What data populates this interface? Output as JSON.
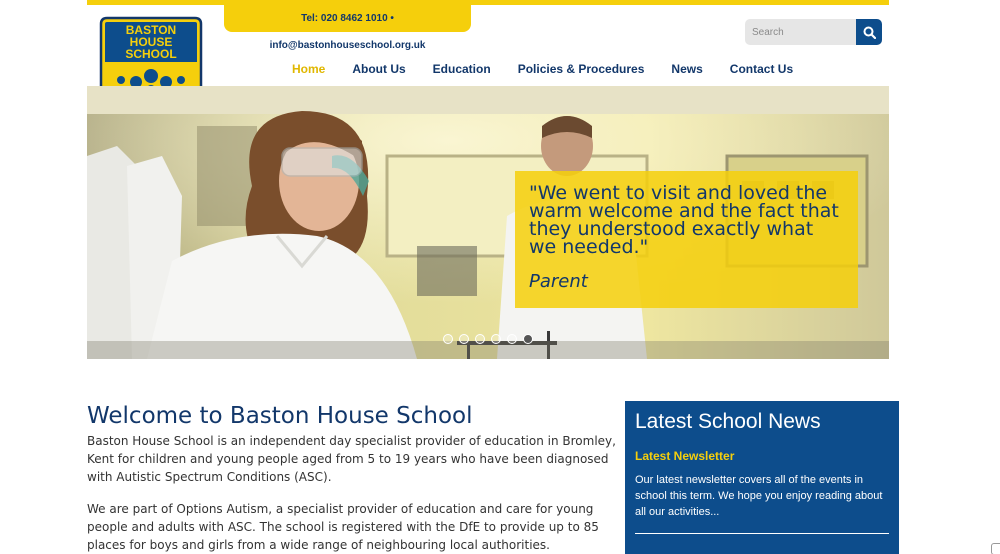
{
  "header": {
    "contact": "Tel: 020 8462 1010 • info@bastonhouseschool.org.uk",
    "logo_text": [
      "BASTON",
      "HOUSE",
      "SCHOOL"
    ],
    "search_placeholder": "Search"
  },
  "nav": {
    "items": [
      {
        "label": "Home",
        "active": true
      },
      {
        "label": "About Us",
        "active": false
      },
      {
        "label": "Education",
        "active": false
      },
      {
        "label": "Policies & Procedures",
        "active": false
      },
      {
        "label": "News",
        "active": false
      },
      {
        "label": "Contact Us",
        "active": false
      }
    ]
  },
  "hero": {
    "quote": "\"We went to visit and loved the warm welcome and the fact that they understood exactly what we needed.\"",
    "author": "Parent",
    "slide_count": 6,
    "active_slide": 6
  },
  "welcome": {
    "title": "Welcome to Baston House School",
    "para1": "Baston House School is an independent day specialist provider of education in Bromley, Kent for children and young people aged from 5 to 19 years who have been diagnosed with Autistic Spectrum Conditions (ASC).",
    "para2": "We are part of Options Autism, a specialist provider of education and care for young people and adults with ASC. The school is registered with the DfE to provide up to 85 places for boys and girls from a wide range of neighbouring local authorities."
  },
  "news": {
    "title": "Latest School News",
    "item_title": "Latest Newsletter",
    "item_text": "Our latest newsletter covers all of the events in school this term. We hope you enjoy reading about all our activities..."
  },
  "colors": {
    "brand_blue": "#12376a",
    "panel_blue": "#0d4d8c",
    "brand_yellow": "#f5cf0c"
  }
}
